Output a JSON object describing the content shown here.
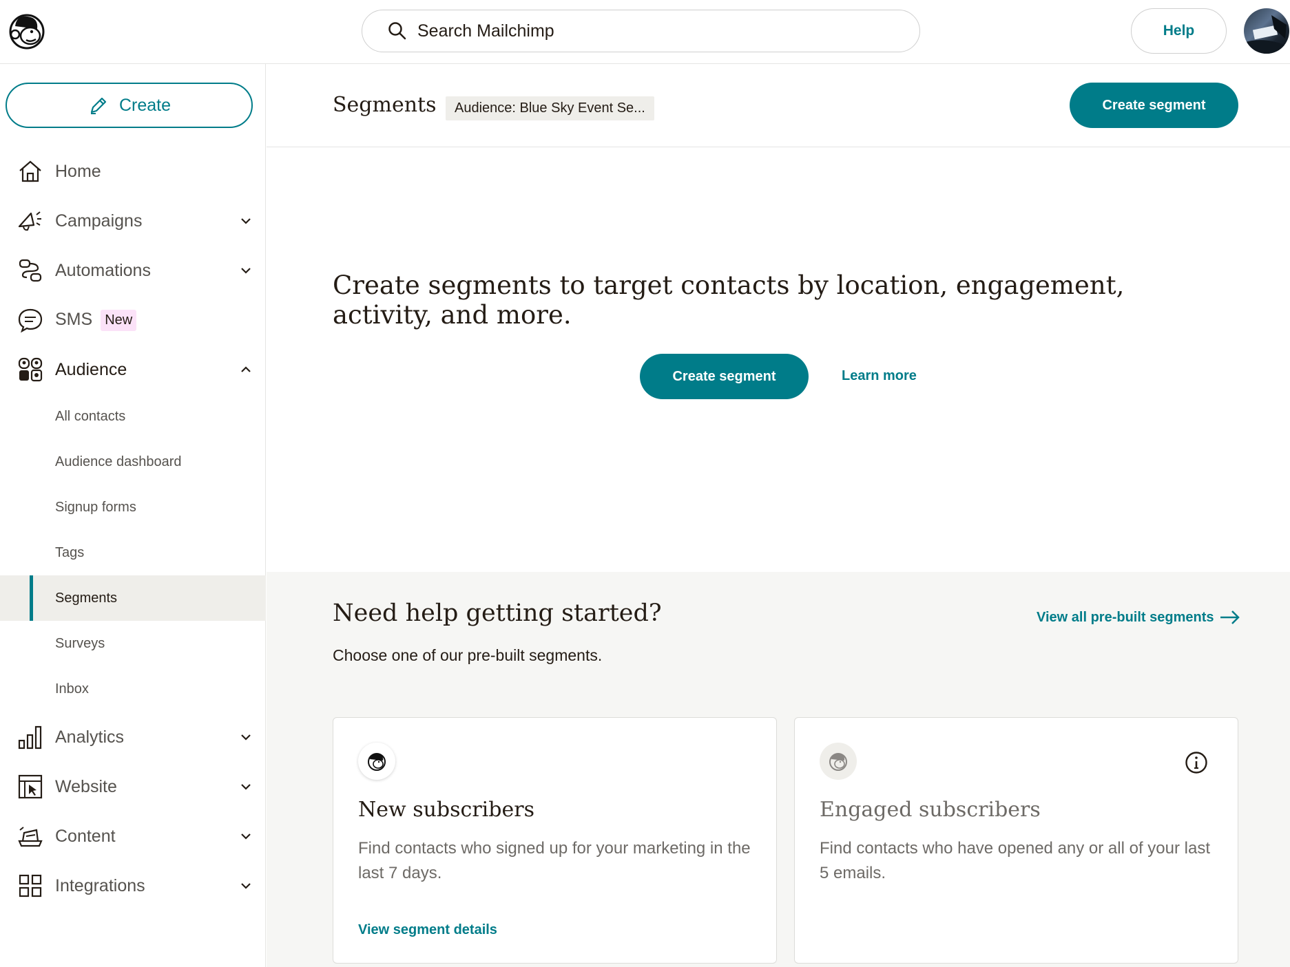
{
  "app": {
    "search_placeholder": "Search Mailchimp",
    "help_label": "Help"
  },
  "sidebar": {
    "create_label": "Create",
    "nav": [
      {
        "label": "Home",
        "icon": "home-icon"
      },
      {
        "label": "Campaigns",
        "icon": "megaphone-icon"
      },
      {
        "label": "Automations",
        "icon": "automations-icon"
      },
      {
        "label": "SMS",
        "icon": "chat-icon",
        "badge": "New"
      },
      {
        "label": "Audience",
        "icon": "audience-icon"
      },
      {
        "label": "Analytics",
        "icon": "bar-chart-icon"
      },
      {
        "label": "Website",
        "icon": "website-icon"
      },
      {
        "label": "Content",
        "icon": "content-icon"
      },
      {
        "label": "Integrations",
        "icon": "grid-icon"
      }
    ],
    "audience_sub": [
      "All contacts",
      "Audience dashboard",
      "Signup forms",
      "Tags",
      "Segments",
      "Surveys",
      "Inbox"
    ],
    "selected_sub": "Segments"
  },
  "main": {
    "title": "Segments",
    "audience_chip": "Audience: Blue Sky Event Se...",
    "create_segment_label": "Create segment",
    "hero_text": "Create segments to target contacts by location, engagement, activity, and more.",
    "hero_create_label": "Create segment",
    "learn_more_label": "Learn more"
  },
  "help": {
    "title": "Need help getting started?",
    "subtitle": "Choose one of our pre-built segments.",
    "view_all_label": "View all pre-built segments",
    "cards": [
      {
        "title": "New subscribers",
        "description": "Find contacts who signed up for your marketing in the last 7 days.",
        "link": "View segment details"
      },
      {
        "title": "Engaged subscribers",
        "description": "Find contacts who have opened any or all of your last 5 emails."
      }
    ]
  },
  "colors": {
    "accent": "#007c89",
    "text": "#241c15",
    "muted": "#55524e",
    "badge_bg": "#fbe2f8",
    "section_bg": "#f6f6f4"
  }
}
